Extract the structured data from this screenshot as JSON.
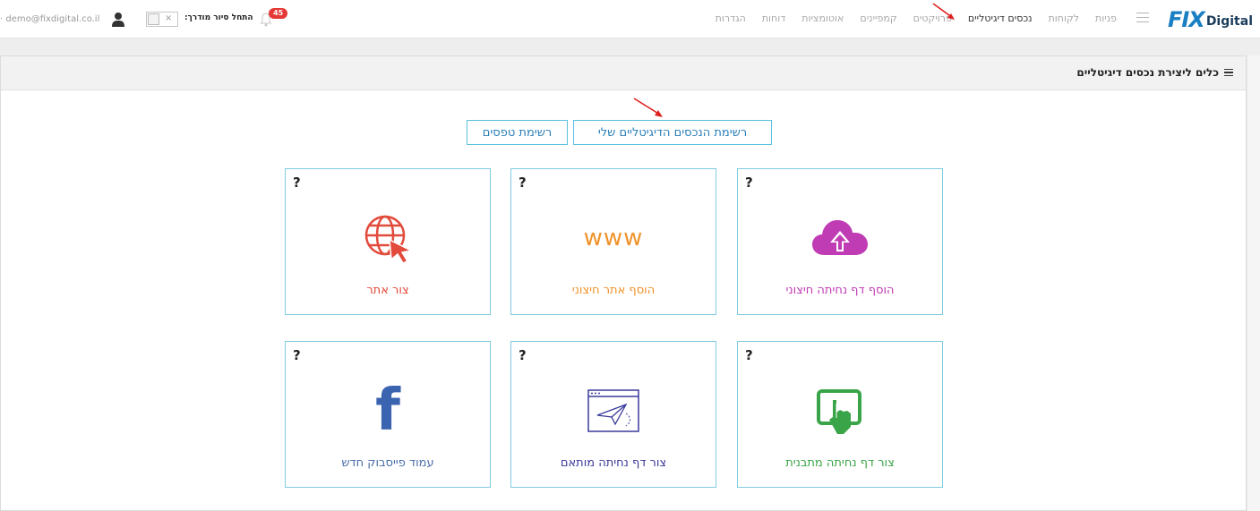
{
  "header": {
    "logo_main": "FIX",
    "logo_sub": "Digital",
    "nav": [
      {
        "label": "פניות",
        "active": false
      },
      {
        "label": "לקוחות",
        "active": false
      },
      {
        "label": "נכסים דיגיטליים",
        "active": true
      },
      {
        "label": "פרויקטים",
        "active": false
      },
      {
        "label": "קמפיינים",
        "active": false
      },
      {
        "label": "אוטומציות",
        "active": false
      },
      {
        "label": "דוחות",
        "active": false
      },
      {
        "label": "הגדרות",
        "active": false
      }
    ],
    "notifications_count": "45",
    "tour_label": "התחל סיור מודרך:",
    "toggle_x": "×",
    "user_email": "· demo@fixdigital.co.il"
  },
  "panel": {
    "title": "כלים ליצירת נכסים דיגיטליים"
  },
  "tabs": {
    "my_assets": "רשימת הנכסים הדיגיטליים שלי",
    "forms": "רשימת טפסים"
  },
  "cards": [
    {
      "q": "?",
      "label": "הוסף דף נחיתה חיצוני",
      "color": "#c03cb4",
      "icon": "cloud-upload-icon"
    },
    {
      "q": "?",
      "label": "הוסף אתר חיצוני",
      "color": "#f0932b",
      "icon": "www-icon",
      "icon_text": "www"
    },
    {
      "q": "?",
      "label": "צור אתר",
      "color": "#e24a3b",
      "icon": "globe-cursor-icon"
    },
    {
      "q": "?",
      "label": "צור דף נחיתה מתבנית",
      "color": "#3aa548",
      "icon": "touch-screen-icon"
    },
    {
      "q": "?",
      "label": "צור דף נחיתה מותאם",
      "color": "#3a3a9a",
      "icon": "paper-plane-window-icon"
    },
    {
      "q": "?",
      "label": "עמוד פייסבוק חדש",
      "color": "#4a6ea9",
      "icon": "facebook-icon",
      "icon_text": "f"
    }
  ]
}
